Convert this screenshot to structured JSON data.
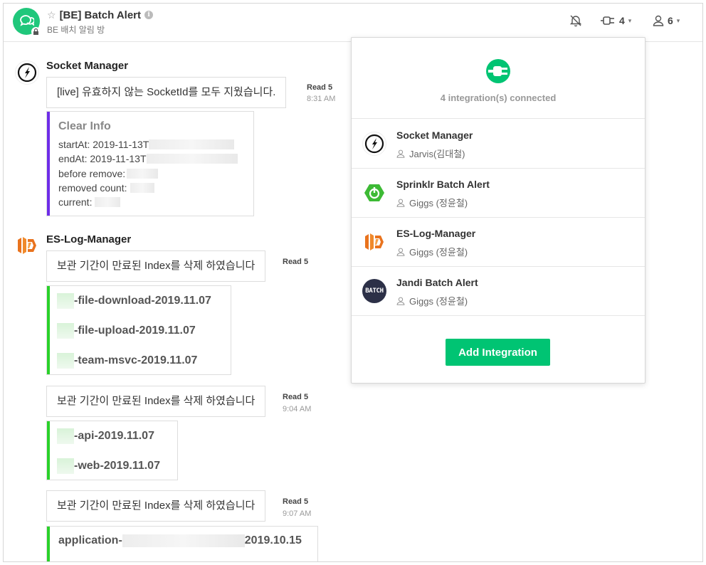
{
  "header": {
    "room_title": "[BE] Batch Alert",
    "room_subtitle": "BE 배치 알림 방",
    "integrations_count": "4",
    "members_count": "6"
  },
  "messages": [
    {
      "sender": "Socket Manager",
      "text": "[live] 유효하지 않는 SocketId를 모두 지웠습니다.",
      "read": "Read 5",
      "time": "8:31 AM",
      "attachment": {
        "title": "Clear Info",
        "lines": [
          "startAt: 2019-11-13T",
          "endAt: 2019-11-13T",
          "before remove:",
          "removed count:",
          "current:"
        ]
      }
    },
    {
      "sender": "ES-Log-Manager",
      "text": "보관 기간이 만료된 Index를 삭제 하였습니다",
      "read": "Read 5",
      "time": "",
      "attachment": {
        "lines": [
          "-file-download-2019.11.07",
          "-file-upload-2019.11.07",
          "-team-msvc-2019.11.07"
        ]
      }
    },
    {
      "text": "보관 기간이 만료된 Index를 삭제 하였습니다",
      "read": "Read 5",
      "time": "9:04 AM",
      "attachment": {
        "lines": [
          "-api-2019.11.07",
          "-web-2019.11.07"
        ]
      }
    },
    {
      "text": "보관 기간이 만료된 Index를 삭제 하였습니다",
      "read": "Read 5",
      "time": "9:07 AM",
      "attachment": {
        "prefix": "application-",
        "suffix": "2019.10.15"
      }
    }
  ],
  "popover": {
    "count_text": "4 integration(s) connected",
    "integrations": [
      {
        "name": "Socket Manager",
        "owner": "Jarvis(김대철)",
        "icon": "socketio-icon"
      },
      {
        "name": "Sprinklr Batch Alert",
        "owner": "Giggs (정윤철)",
        "icon": "spring-icon"
      },
      {
        "name": "ES-Log-Manager",
        "owner": "Giggs (정윤철)",
        "icon": "aws-lambda-icon"
      },
      {
        "name": "Jandi Batch Alert",
        "owner": "Giggs (정윤철)",
        "icon": "batch-icon",
        "icon_text": "BATCH"
      }
    ],
    "add_button": "Add Integration"
  },
  "colors": {
    "accent": "#00c473",
    "clear_info_bar": "#6e2de8",
    "index_bar": "#2ad12a"
  }
}
